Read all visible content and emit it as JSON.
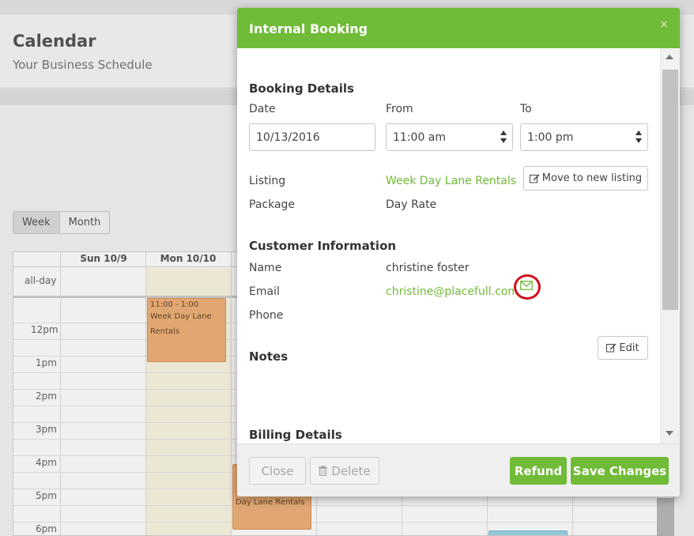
{
  "page": {
    "title": "Calendar",
    "subtitle": "Your Business Schedule"
  },
  "view_toggle": [
    "Week",
    "Month"
  ],
  "calendar": {
    "days": [
      "Sun 10/9",
      "Mon 10/10"
    ],
    "allday_label": "all-day",
    "times": [
      "12pm",
      "1pm",
      "2pm",
      "3pm",
      "4pm",
      "5pm",
      "6pm"
    ],
    "events": [
      {
        "time": "11:00 - 1:00",
        "title": "Week Day Lane Rentals"
      },
      {
        "title": "Day Lane Rentals"
      }
    ]
  },
  "modal": {
    "title": "Internal Booking",
    "close_symbol": "×",
    "booking_details": {
      "heading": "Booking Details",
      "date_label": "Date",
      "date_value": "10/13/2016",
      "from_label": "From",
      "from_value": "11:00 am",
      "to_label": "To",
      "to_value": "1:00 pm",
      "listing_label": "Listing",
      "listing_value": "Week Day Lane Rentals",
      "move_button": "Move to new listing",
      "package_label": "Package",
      "package_value": "Day Rate"
    },
    "customer": {
      "heading": "Customer Information",
      "name_label": "Name",
      "name_value": "christine foster",
      "email_label": "Email",
      "email_value": "christine@placefull.com",
      "phone_label": "Phone"
    },
    "notes": {
      "heading": "Notes",
      "edit_button": "Edit"
    },
    "billing": {
      "heading": "Billing Details"
    },
    "footer": {
      "close_button": "Close",
      "delete_button": "Delete",
      "refund_button": "Refund",
      "save_button": "Save Changes"
    }
  },
  "colors": {
    "accent_green": "#70bb37",
    "highlight_red": "#d0101c",
    "event_orange": "#f0b27a"
  },
  "icons": {
    "move": "edit-icon",
    "edit": "edit-icon",
    "delete": "trash-icon",
    "email": "envelope-icon"
  }
}
